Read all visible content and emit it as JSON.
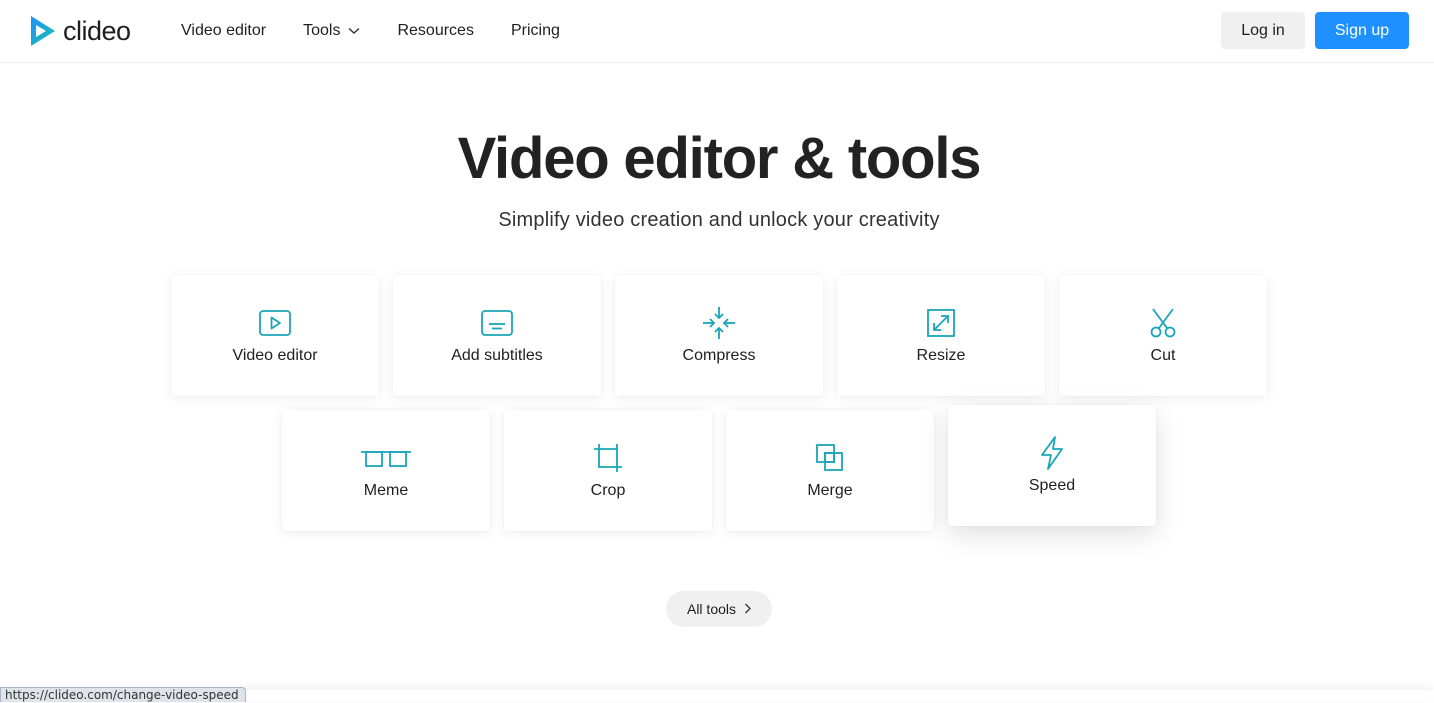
{
  "brand": {
    "name": "clideo",
    "logo_icon": "play-triangle-logo",
    "accent_color": "#1e90ff",
    "icon_color": "#1aa6b7"
  },
  "nav": {
    "items": [
      {
        "label": "Video editor"
      },
      {
        "label": "Tools",
        "has_dropdown": true
      },
      {
        "label": "Resources"
      },
      {
        "label": "Pricing"
      }
    ],
    "login_label": "Log in",
    "signup_label": "Sign up"
  },
  "hero": {
    "title": "Video editor & tools",
    "subtitle": "Simplify video creation and unlock your creativity"
  },
  "tools": [
    {
      "label": "Video editor",
      "icon": "play-icon"
    },
    {
      "label": "Add subtitles",
      "icon": "subtitles-icon"
    },
    {
      "label": "Compress",
      "icon": "compress-icon"
    },
    {
      "label": "Resize",
      "icon": "resize-icon"
    },
    {
      "label": "Cut",
      "icon": "scissors-icon"
    },
    {
      "label": "Meme",
      "icon": "glasses-icon"
    },
    {
      "label": "Crop",
      "icon": "crop-icon"
    },
    {
      "label": "Merge",
      "icon": "merge-icon"
    },
    {
      "label": "Speed",
      "icon": "lightning-icon",
      "hovered": true
    }
  ],
  "all_tools_label": "All tools",
  "status_bar": {
    "url": "https://clideo.com/change-video-speed"
  }
}
